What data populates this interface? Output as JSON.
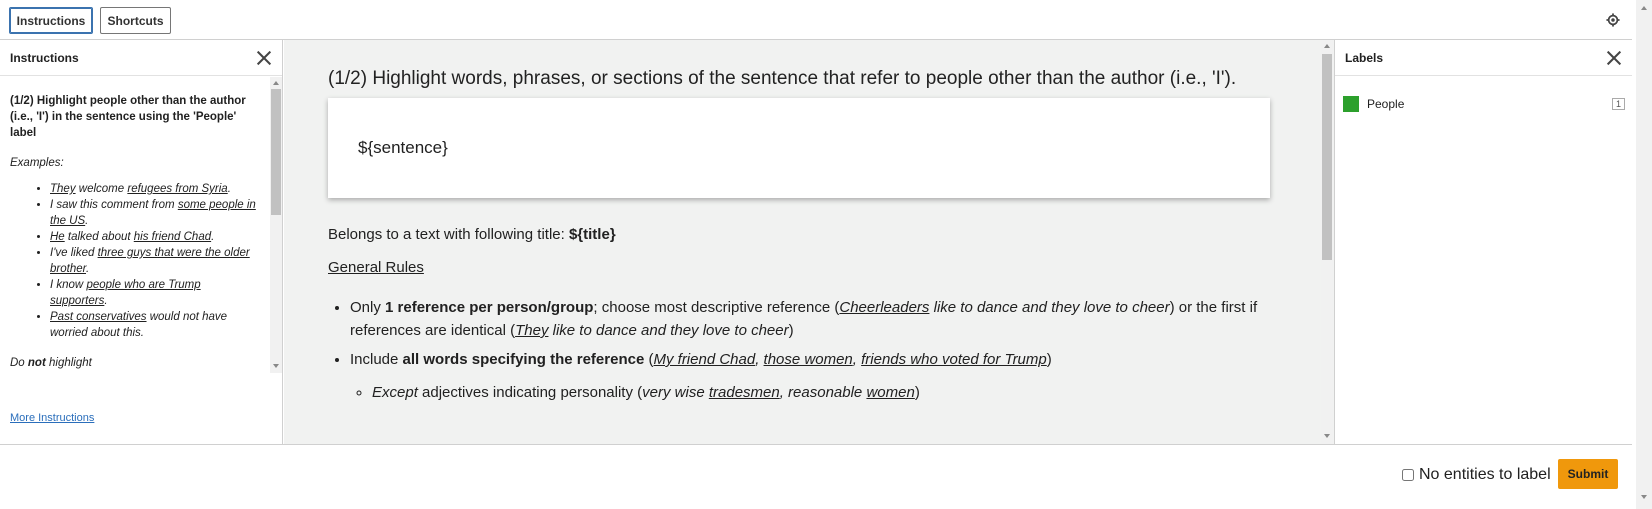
{
  "topbar": {
    "tabs": [
      {
        "label": "Instructions"
      },
      {
        "label": "Shortcuts"
      }
    ],
    "settings_icon": "gear-icon"
  },
  "left_panel": {
    "title": "Instructions",
    "close_icon": "close-icon",
    "instruction_bold": "(1/2) Highlight people other than the author (i.e., 'I') in the sentence using the 'People' label",
    "examples_label": "Examples:",
    "do_not_prefix": "Do ",
    "do_not_bold": "not",
    "do_not_suffix": " highlight",
    "more_link": "More Instructions"
  },
  "center": {
    "title": "(1/2) Highlight words, phrases, or sections of the sentence that refer to people other than the author (i.e., 'I').",
    "sentence": "${sentence}",
    "belongs_prefix": "Belongs to a text with following title: ",
    "belongs_title": "${title}",
    "general_rules": "General Rules"
  },
  "right_panel": {
    "title": "Labels",
    "close_icon": "close-icon",
    "labels": [
      {
        "name": "People",
        "color": "#2ca02c",
        "shortcut": "1"
      }
    ]
  },
  "footer": {
    "no_entities_label": "No entities to label",
    "submit_label": "Submit"
  }
}
